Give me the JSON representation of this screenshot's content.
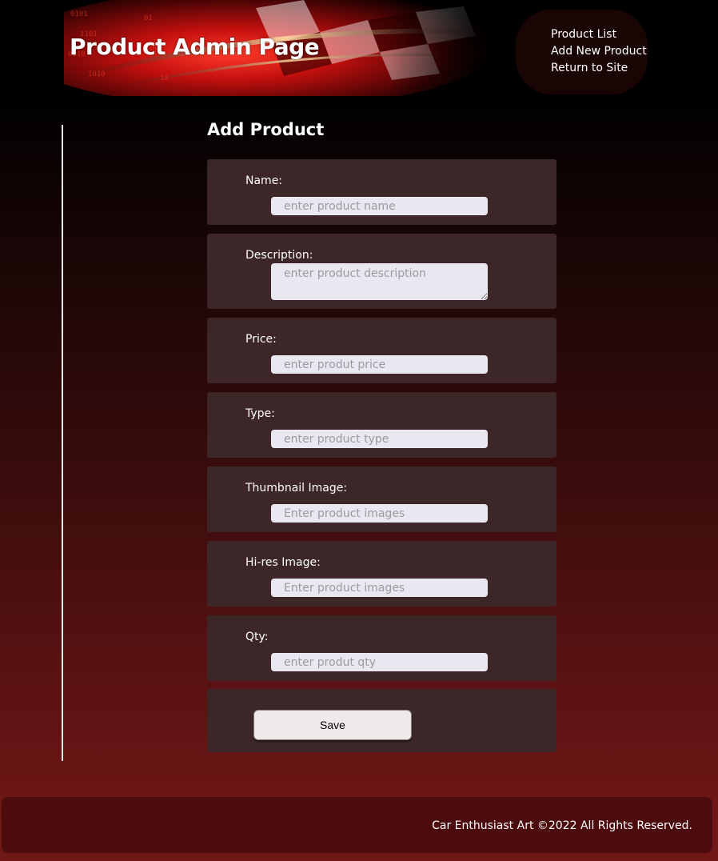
{
  "header": {
    "title": "Product Admin Page",
    "nav": [
      {
        "label": "Product List"
      },
      {
        "label": "Add New Product"
      },
      {
        "label": "Return to Site"
      }
    ]
  },
  "form": {
    "title": "Add Product",
    "fields": [
      {
        "label": "Name:",
        "placeholder": "enter product name",
        "value": ""
      },
      {
        "label": "Description:",
        "placeholder": "enter product description",
        "value": ""
      },
      {
        "label": "Price:",
        "placeholder": "enter produt price",
        "value": ""
      },
      {
        "label": "Type:",
        "placeholder": "enter product type",
        "value": ""
      },
      {
        "label": "Thumbnail Image:",
        "placeholder": "Enter product images",
        "value": ""
      },
      {
        "label": "Hi-res Image:",
        "placeholder": "Enter product images",
        "value": ""
      },
      {
        "label": "Qty:",
        "placeholder": "enter produt qty",
        "value": ""
      }
    ],
    "save_label": "Save"
  },
  "footer": {
    "text": "Car Enthusiast Art ©2022 All Rights Reserved."
  },
  "colors": {
    "card_background": "#3d2627",
    "input_background": "#e9e8f0",
    "footer_background": "#4c0c0e",
    "accent_red": "#d41a1a"
  }
}
